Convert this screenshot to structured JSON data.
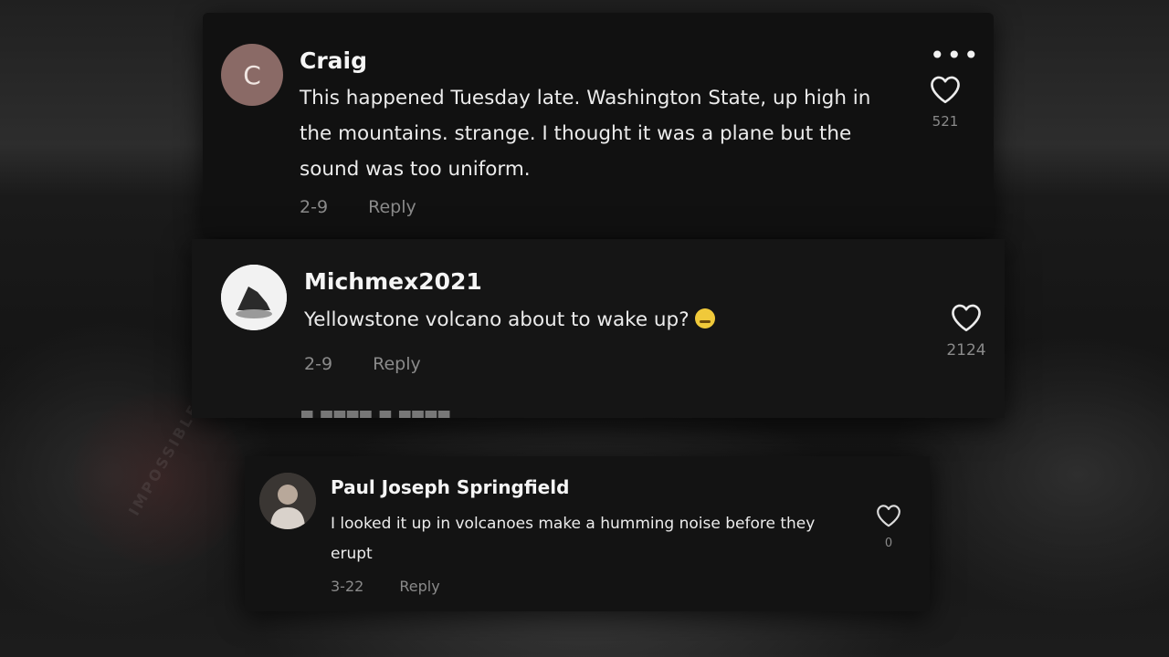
{
  "comments": [
    {
      "avatar_letter": "C",
      "username": "Craig",
      "text": "This happened Tuesday late. Washington State, up high in the mountains. strange. I thought it was a plane but the sound was too uniform.",
      "date": "2-9",
      "reply_label": "Reply",
      "likes": "521",
      "more_icon": "ellipsis-icon",
      "like_icon": "heart-icon"
    },
    {
      "username": "Michmex2021",
      "text": "Yellowstone volcano about to wake up?",
      "emoji": "grimace-emoji",
      "date": "2-9",
      "reply_label": "Reply",
      "likes": "2124",
      "like_icon": "heart-icon"
    },
    {
      "username": "Paul Joseph Springfield",
      "text": "I looked it up in volcanoes make a humming noise before they erupt",
      "date": "3-22",
      "reply_label": "Reply",
      "likes": "0",
      "like_icon": "heart-icon"
    }
  ],
  "colors": {
    "card_background": "#121212",
    "username": "#f5f5f5",
    "comment_text": "#ececec",
    "meta_text": "#8a8a8a",
    "avatar_craig": "#8a6a66",
    "emoji": "#f0c93a"
  }
}
